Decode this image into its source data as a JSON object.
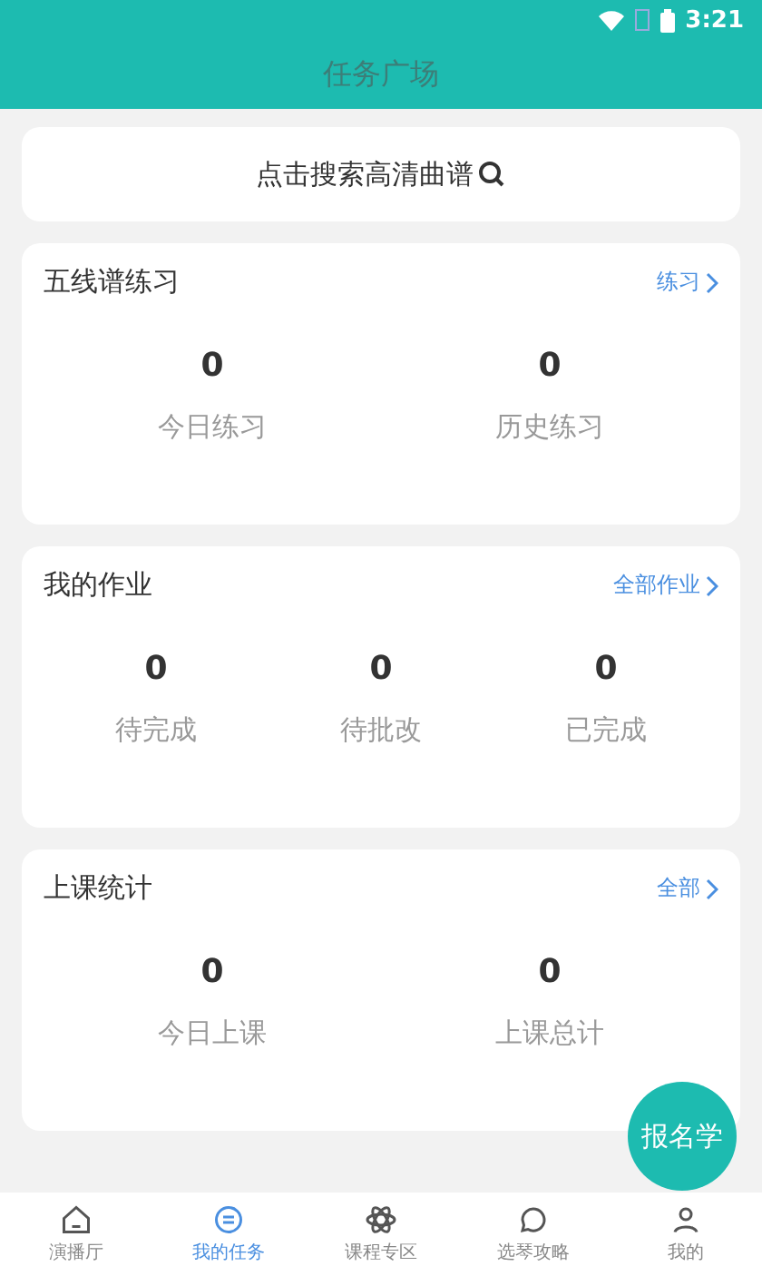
{
  "status_bar": {
    "time": "3:21"
  },
  "header": {
    "title": "任务广场"
  },
  "search": {
    "placeholder": "点击搜索高清曲谱"
  },
  "sections": [
    {
      "title": "五线谱练习",
      "link": "练习",
      "stats": [
        {
          "value": "0",
          "label": "今日练习"
        },
        {
          "value": "0",
          "label": "历史练习"
        }
      ]
    },
    {
      "title": "我的作业",
      "link": "全部作业",
      "stats": [
        {
          "value": "0",
          "label": "待完成"
        },
        {
          "value": "0",
          "label": "待批改"
        },
        {
          "value": "0",
          "label": "已完成"
        }
      ]
    },
    {
      "title": "上课统计",
      "link": "全部",
      "stats": [
        {
          "value": "0",
          "label": "今日上课"
        },
        {
          "value": "0",
          "label": "上课总计"
        }
      ]
    }
  ],
  "floating_button": "报名学",
  "tabs": [
    {
      "label": "演播厅",
      "kind": "home",
      "selected": false
    },
    {
      "label": "我的任务",
      "kind": "task",
      "selected": true
    },
    {
      "label": "课程专区",
      "kind": "course",
      "selected": false
    },
    {
      "label": "选琴攻略",
      "kind": "guide",
      "selected": false
    },
    {
      "label": "我的",
      "kind": "profile",
      "selected": false
    }
  ]
}
